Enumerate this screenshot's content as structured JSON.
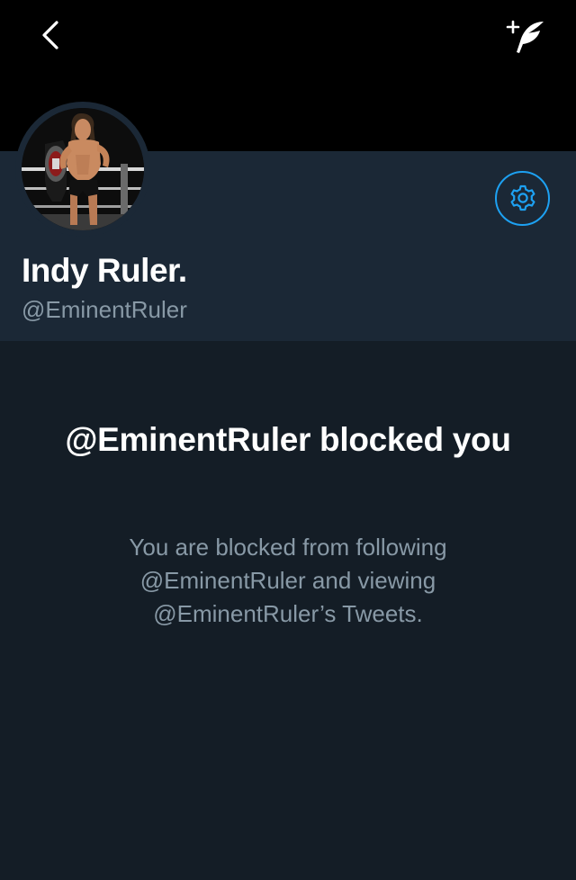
{
  "nav": {
    "back_icon": "chevron-left-icon",
    "compose_icon": "compose-tweet-feather-icon"
  },
  "profile": {
    "display_name": "Indy Ruler.",
    "handle": "@EminentRuler",
    "avatar": "wrestler-holding-championship-belt",
    "settings_icon": "gear-icon"
  },
  "blocked": {
    "title": "@EminentRuler blocked you",
    "description_lines": [
      "You are blocked from following",
      "@EminentRuler and viewing",
      "@EminentRuler’s Tweets."
    ]
  },
  "colors": {
    "background": "#141d26",
    "header_card": "#1b2836",
    "banner": "#000000",
    "accent": "#1da1f2",
    "secondary_text": "#8899a6",
    "primary_text": "#ffffff"
  }
}
